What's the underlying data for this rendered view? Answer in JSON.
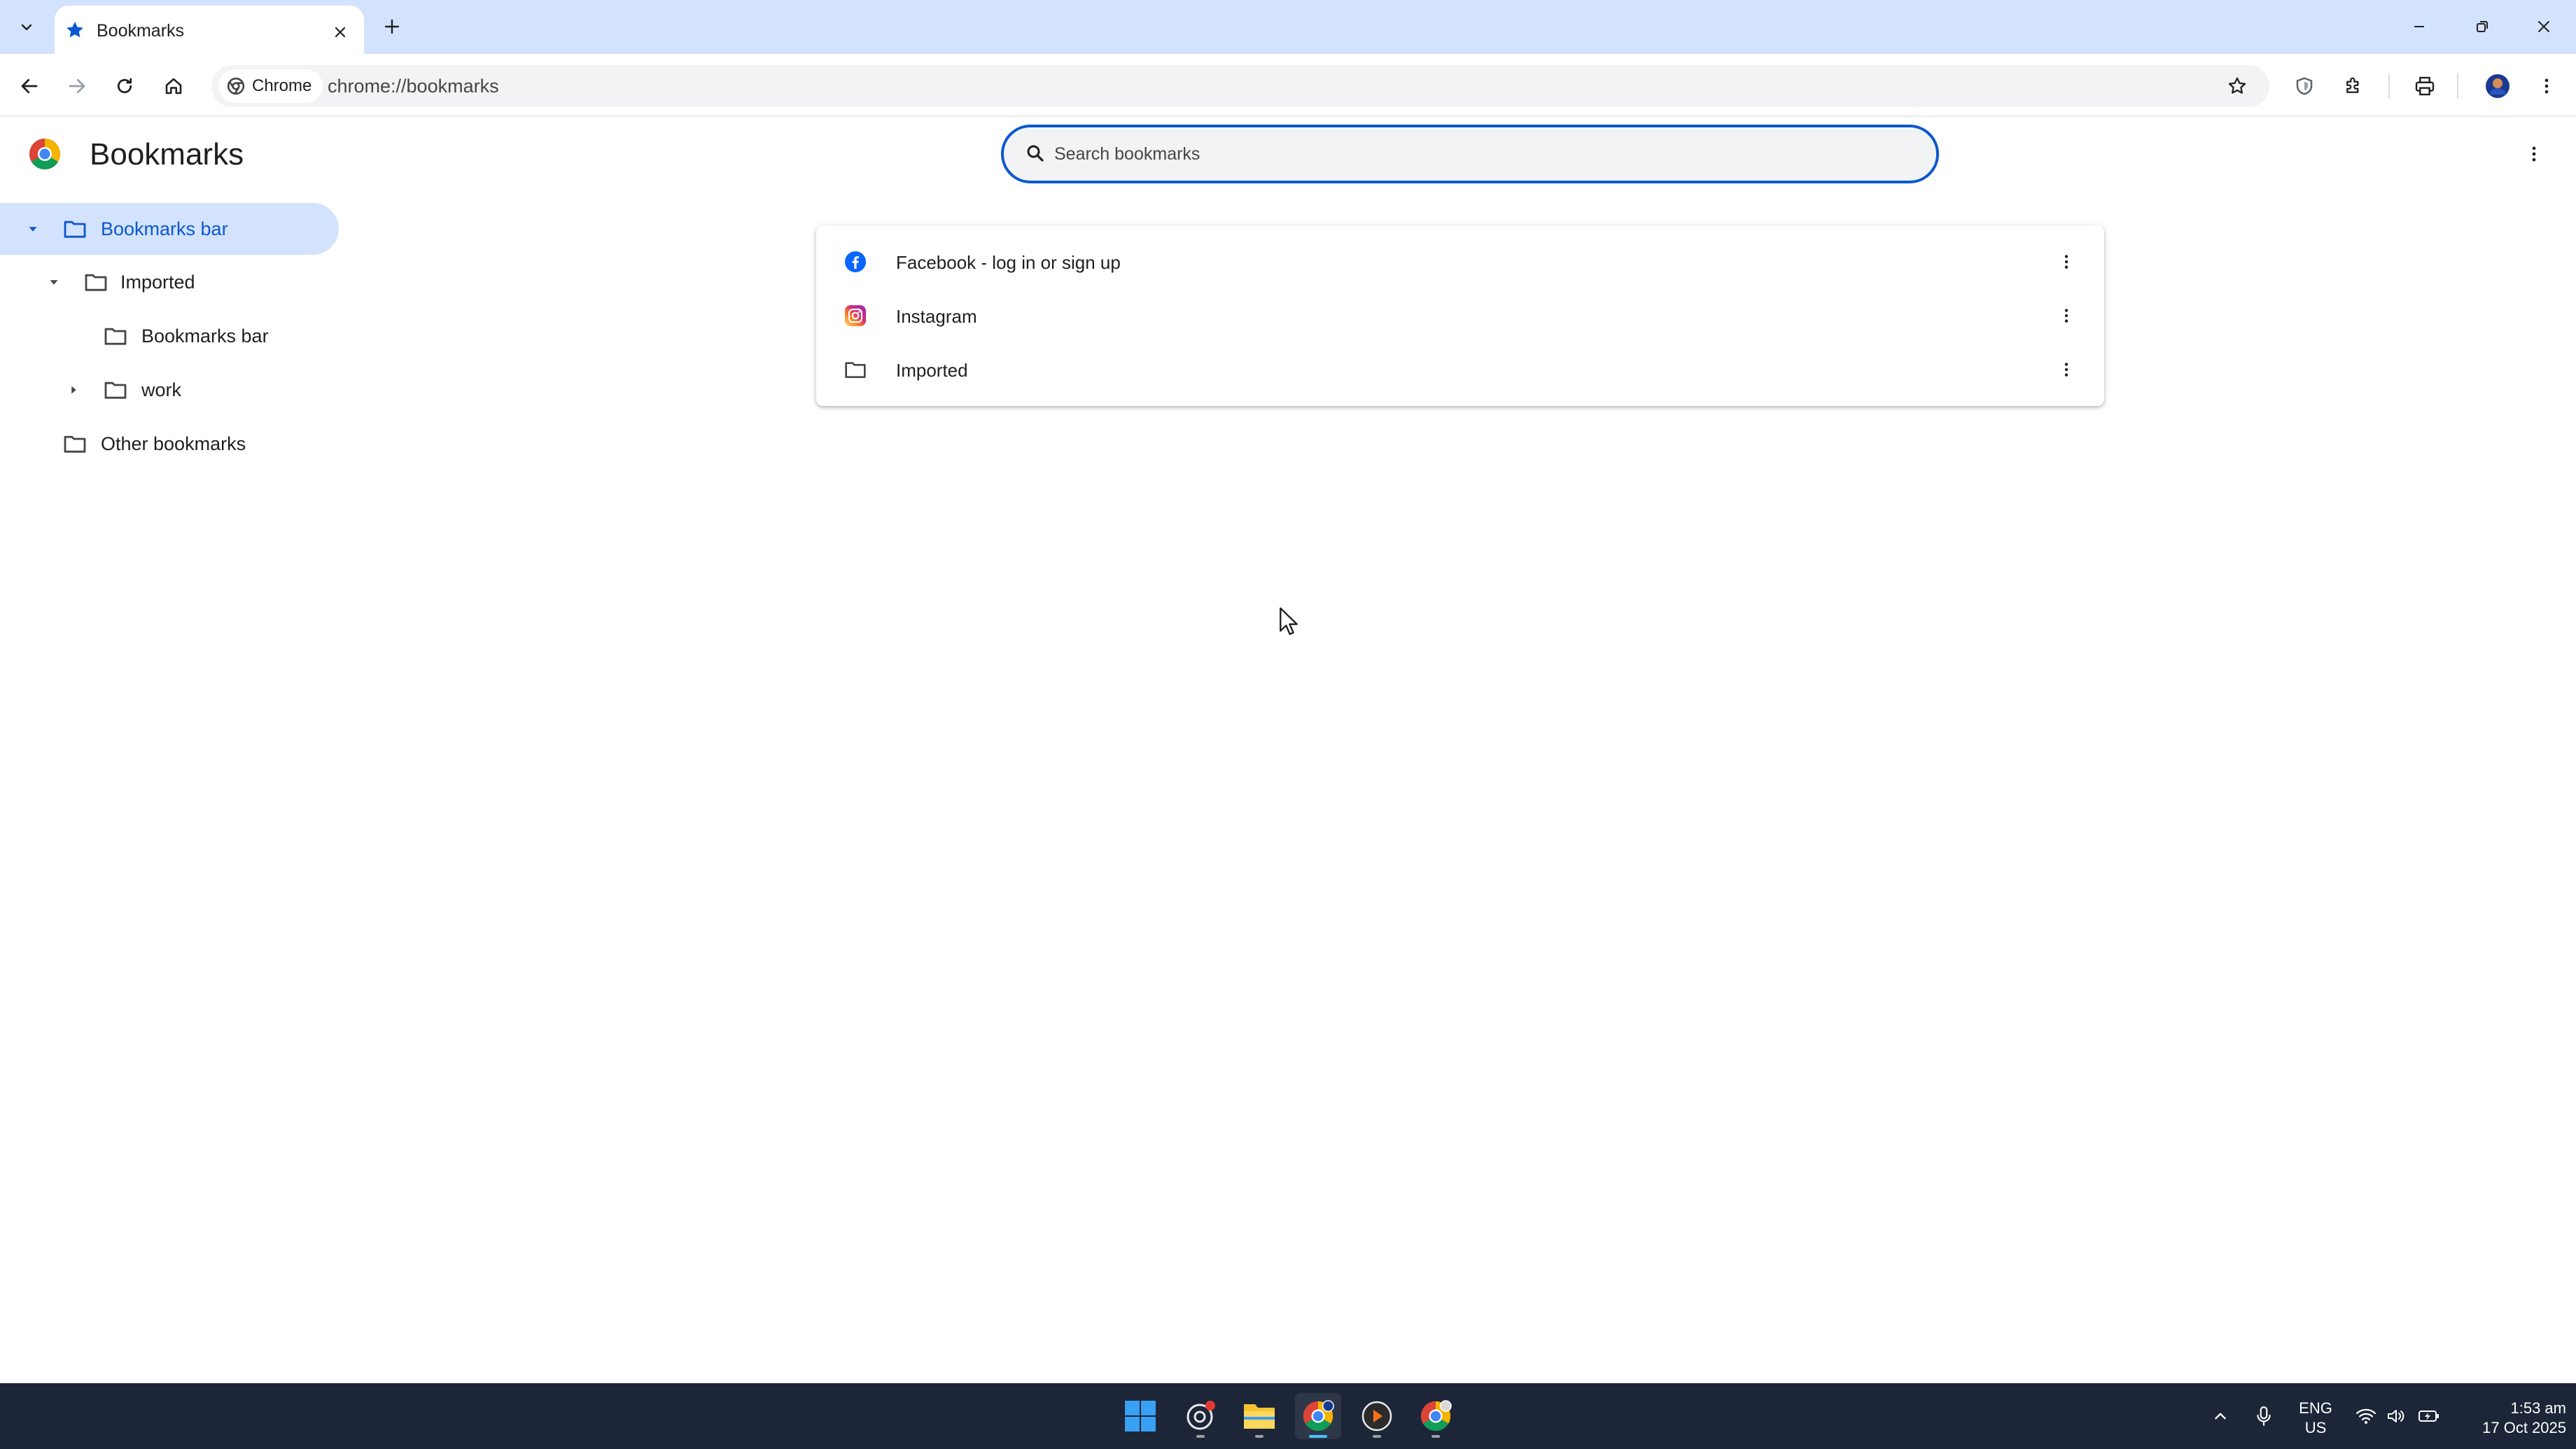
{
  "tab": {
    "title": "Bookmarks"
  },
  "toolbar": {
    "chip_label": "Chrome",
    "url": "chrome://bookmarks"
  },
  "page": {
    "title": "Bookmarks",
    "search_placeholder": "Search bookmarks"
  },
  "sidebar": {
    "items": [
      {
        "label": "Bookmarks bar",
        "expanded": true,
        "selected": true
      },
      {
        "label": "Imported",
        "expanded": true,
        "selected": false
      },
      {
        "label": "Bookmarks bar",
        "expanded": false,
        "selected": false
      },
      {
        "label": "work",
        "expanded": false,
        "selected": false
      },
      {
        "label": "Other bookmarks",
        "expanded": false,
        "selected": false
      }
    ]
  },
  "list": {
    "items": [
      {
        "label": "Facebook - log in or sign up",
        "icon": "facebook-icon"
      },
      {
        "label": "Instagram",
        "icon": "instagram-icon"
      },
      {
        "label": "Imported",
        "icon": "folder-icon"
      }
    ]
  },
  "taskbar": {
    "lang_top": "ENG",
    "lang_bottom": "US",
    "time": "1:53 am",
    "date": "17 Oct 2025"
  },
  "colors": {
    "accent": "#0b57d0",
    "selected_bg": "#d3e3fd",
    "taskbar_bg": "#1c2638"
  }
}
